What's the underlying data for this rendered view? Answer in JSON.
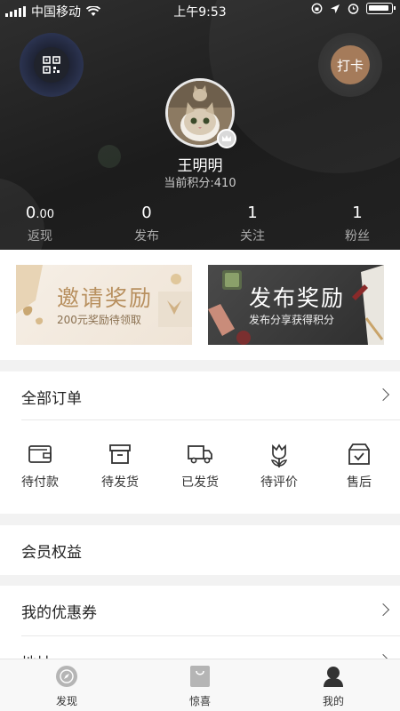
{
  "status_bar": {
    "carrier": "中国移动",
    "time": "上午9:53"
  },
  "header": {
    "punch_label": "打卡",
    "username": "王明明",
    "points": "当前积分:410",
    "stats": [
      {
        "value": "0",
        "decimal": ".00",
        "label": "返现"
      },
      {
        "value": "0",
        "decimal": "",
        "label": "发布"
      },
      {
        "value": "1",
        "decimal": "",
        "label": "关注"
      },
      {
        "value": "1",
        "decimal": "",
        "label": "粉丝"
      }
    ]
  },
  "banners": {
    "invite": {
      "title": "邀请奖励",
      "subtitle": "200元奖励待领取"
    },
    "publish": {
      "title": "发布奖励",
      "subtitle": "发布分享获得积分"
    }
  },
  "orders": {
    "title": "全部订单",
    "items": [
      {
        "label": "待付款",
        "icon": "wallet-icon"
      },
      {
        "label": "待发货",
        "icon": "box-icon"
      },
      {
        "label": "已发货",
        "icon": "truck-icon"
      },
      {
        "label": "待评价",
        "icon": "tulip-icon"
      },
      {
        "label": "售后",
        "icon": "package-check-icon"
      }
    ]
  },
  "member": {
    "title": "会员权益"
  },
  "coupons": {
    "title": "我的优惠券",
    "next_row_title": "地址"
  },
  "tabbar": {
    "tabs": [
      {
        "label": "发现",
        "icon": "compass-icon"
      },
      {
        "label": "惊喜",
        "icon": "bag-icon"
      },
      {
        "label": "我的",
        "icon": "user-icon"
      }
    ]
  },
  "colors": {
    "accent": "#a57b5a",
    "header_bg": "#222222",
    "gold": "#b8905f"
  }
}
